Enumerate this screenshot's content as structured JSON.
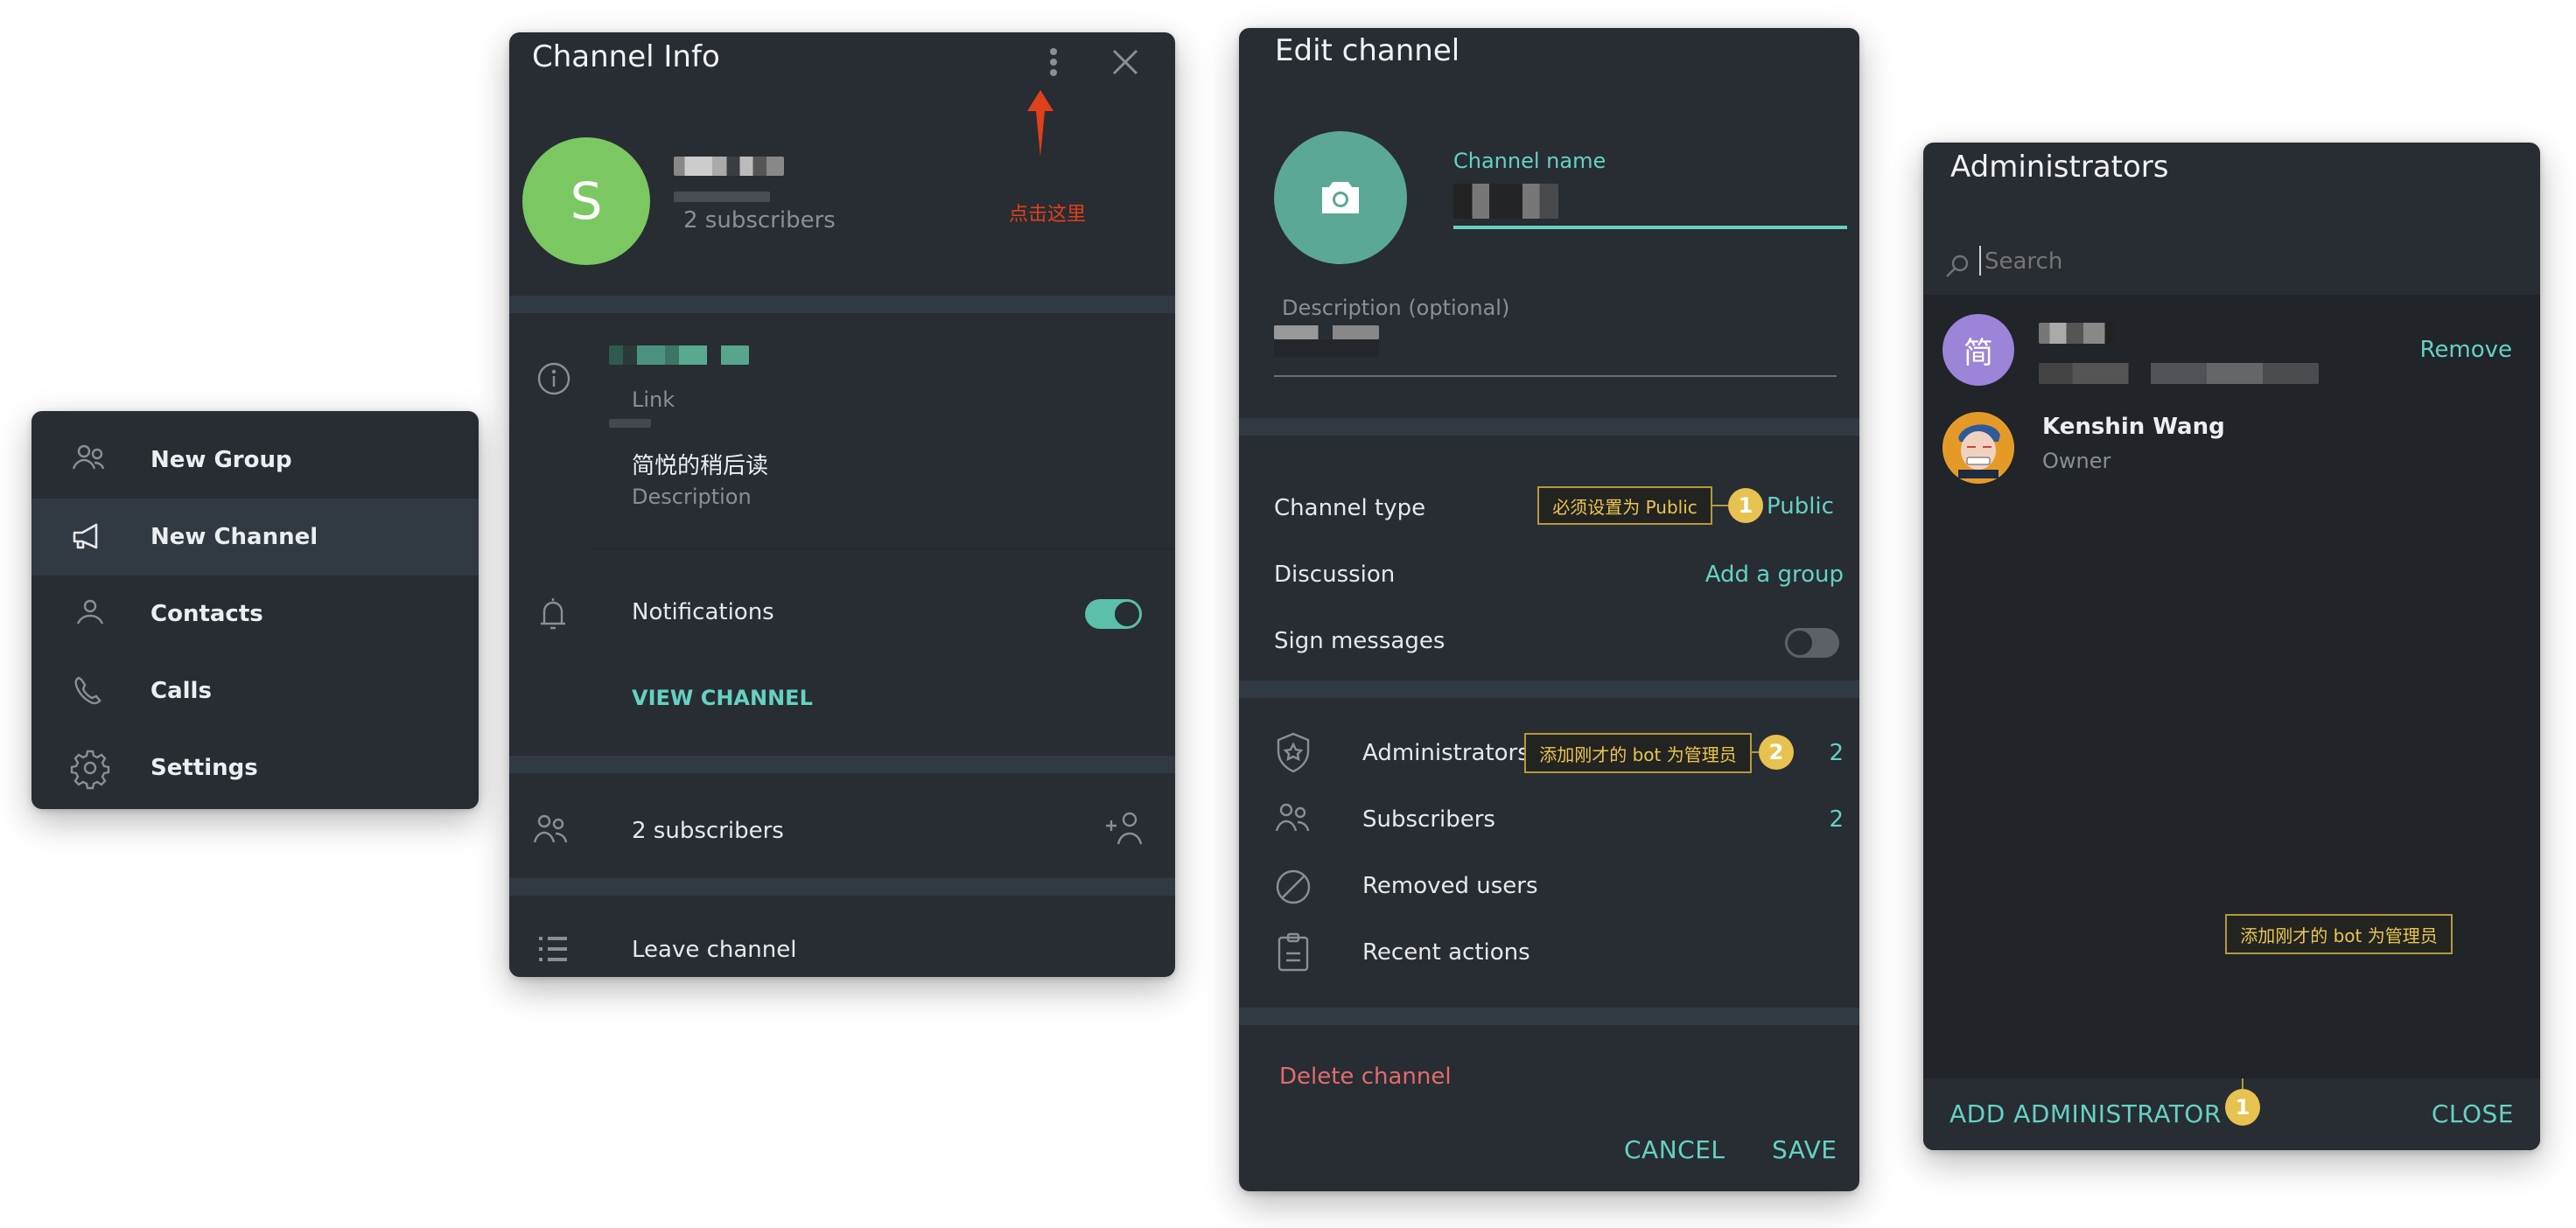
{
  "menu": {
    "items": [
      {
        "label": "New Group",
        "icon": "group-icon",
        "active": false
      },
      {
        "label": "New Channel",
        "icon": "megaphone-icon",
        "active": true
      },
      {
        "label": "Contacts",
        "icon": "person-icon",
        "active": false
      },
      {
        "label": "Calls",
        "icon": "phone-icon",
        "active": false
      },
      {
        "label": "Settings",
        "icon": "gear-icon",
        "active": false
      }
    ]
  },
  "channel_info": {
    "title": "Channel Info",
    "avatar_letter": "S",
    "avatar_color": "#7bc862",
    "subscribers_text": "2 subscribers",
    "annotation": "点击这里",
    "link_label": "Link",
    "description_value": "简悦的稍后读",
    "description_label": "Description",
    "notifications_label": "Notifications",
    "notifications_on": true,
    "view_channel": "VIEW CHANNEL",
    "subscribers_row": "2 subscribers",
    "leave_channel": "Leave channel"
  },
  "edit_channel": {
    "title": "Edit channel",
    "avatar_color": "#5aa895",
    "channel_name_label": "Channel name",
    "description_label": "Description (optional)",
    "channel_type_label": "Channel type",
    "channel_type_value": "Public",
    "channel_type_annotation": "必须设置为 Public",
    "channel_type_step": "1",
    "discussion_label": "Discussion",
    "discussion_value": "Add a group",
    "sign_messages_label": "Sign messages",
    "sign_messages_on": false,
    "administrators_label": "Administrators",
    "administrators_count": "2",
    "administrators_annotation": "添加刚才的 bot 为管理员",
    "administrators_step": "2",
    "subscribers_label": "Subscribers",
    "subscribers_count": "2",
    "removed_users_label": "Removed users",
    "recent_actions_label": "Recent actions",
    "delete_channel": "Delete channel",
    "cancel": "CANCEL",
    "save": "SAVE"
  },
  "administrators": {
    "title": "Administrators",
    "search_placeholder": "Search",
    "members": [
      {
        "avatar_text": "简",
        "avatar_color": "#9c84d8",
        "name": "",
        "role": "",
        "action": "Remove"
      },
      {
        "avatar_text": "",
        "name": "Kenshin Wang",
        "role": "Owner",
        "action": ""
      }
    ],
    "add_administrator": "ADD ADMINISTRATOR",
    "add_annotation": "添加刚才的 bot 为管理员",
    "add_step": "1",
    "close": "CLOSE"
  },
  "colors": {
    "accent": "#64d2c2",
    "danger": "#e06c6c",
    "annotation": "#e8c250",
    "arrow": "#e0401a"
  }
}
